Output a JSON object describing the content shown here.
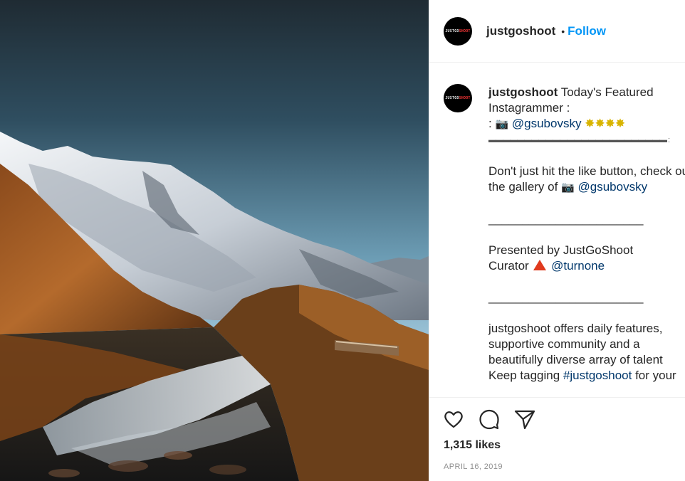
{
  "post": {
    "image_alt": "Snow-capped mountain reflected in an alpine tarn",
    "header": {
      "username": "justgoshoot",
      "separator": "•",
      "follow_label": "Follow",
      "avatar_text_white": "JUSTGO",
      "avatar_text_red": "SHOOT"
    },
    "caption": {
      "username": "justgoshoot",
      "intro": "Today's Featured Instagrammer :",
      "line2_prefix": ":",
      "camera_glyph": "📷",
      "mention1": "@gsubovsky",
      "stars": "✸✸✸✸",
      "divider": "▬▬▬▬▬▬▬▬▬▬▬▬▬▬▬▬▬▬▬▬▬▬▬▬▬ :",
      "para1": "Don't just hit the like button, check out the gallery of",
      "camera_glyph2": "📷",
      "mention2": "@gsubovsky",
      "rule1": "_______________________",
      "presented": "Presented by JustGoShoot",
      "curator_label": "Curator",
      "curator_mention": "@turnone",
      "rule2": "_______________________",
      "para2": "justgoshoot offers daily features, supportive community and a beautifully diverse array of talent",
      "para3_prefix": "Keep tagging",
      "hashtag": "#justgoshoot",
      "para3_suffix": "for your"
    },
    "actions": {
      "like_icon": "heart-icon",
      "comment_icon": "comment-icon",
      "share_icon": "share-icon",
      "likes": "1,315 likes",
      "date": "APRIL 16, 2019"
    }
  }
}
